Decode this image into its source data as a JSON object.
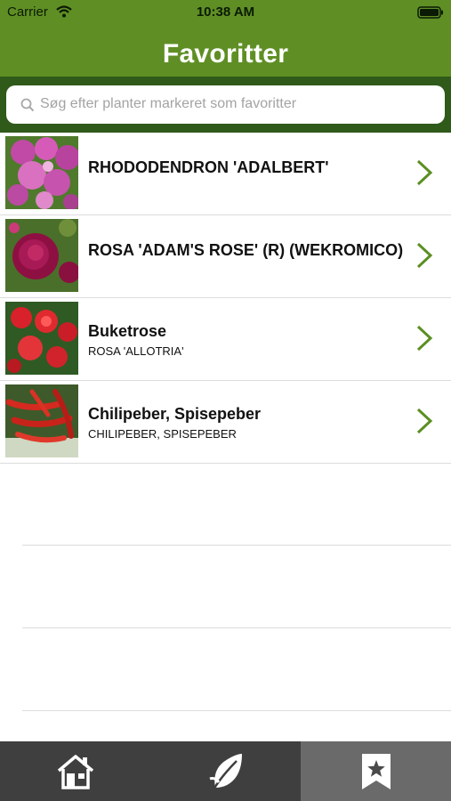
{
  "status_bar": {
    "carrier": "Carrier",
    "time": "10:38 AM"
  },
  "nav": {
    "title": "Favoritter"
  },
  "search": {
    "placeholder": "Søg efter planter markeret som favoritter"
  },
  "favorites": [
    {
      "title": "RHODODENDRON 'ADALBERT'",
      "subtitle": ""
    },
    {
      "title": "ROSA 'ADAM'S ROSE' (R) (WEKROMICO)",
      "subtitle": ""
    },
    {
      "title": "Buketrose",
      "subtitle": "ROSA 'ALLOTRIA'"
    },
    {
      "title": "Chilipeber, Spisepeber",
      "subtitle": "CHILIPEBER, SPISEPEBER"
    }
  ],
  "tabbar": {
    "tabs": [
      {
        "icon": "home-icon",
        "active": false
      },
      {
        "icon": "leaf-icon",
        "active": false
      },
      {
        "icon": "bookmark-star-icon",
        "active": true
      }
    ]
  },
  "colors": {
    "header_green": "#5f8f24",
    "search_bg": "#2f5a1a",
    "chevron_green": "#5b8f22",
    "tabbar_bg": "#3f3f3f"
  }
}
